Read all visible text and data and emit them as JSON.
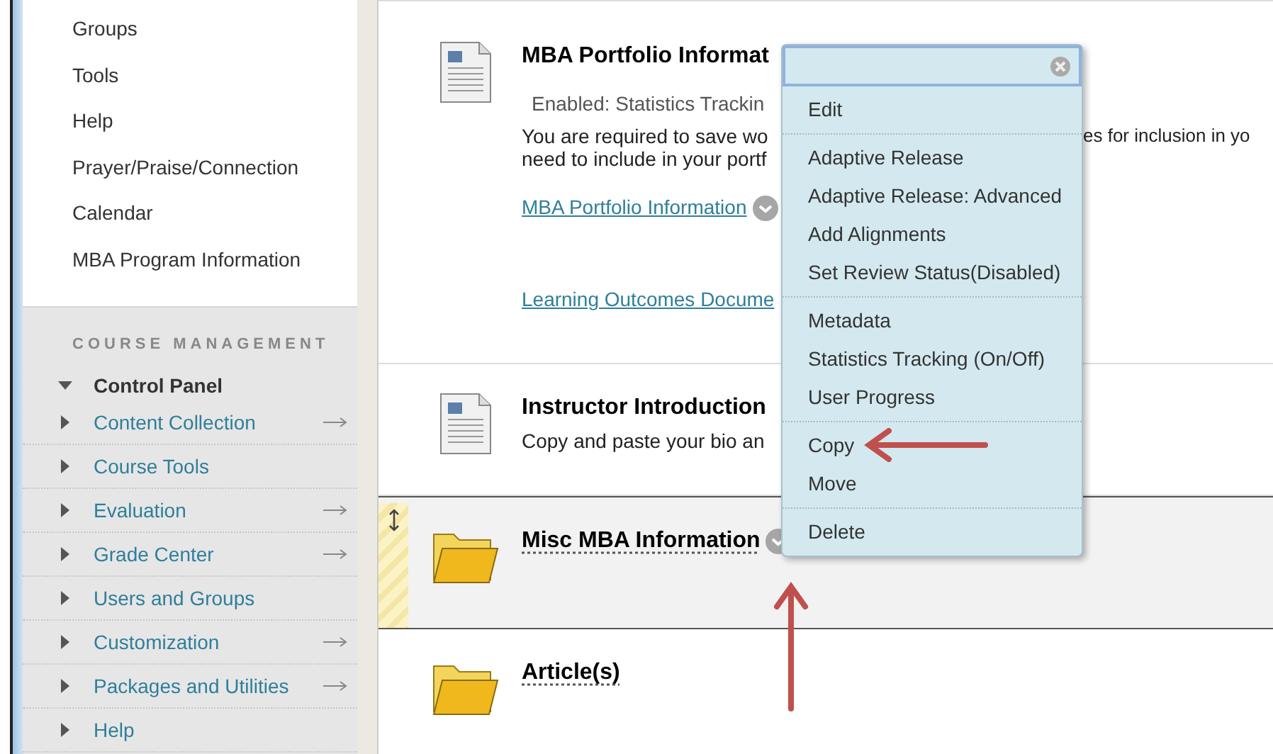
{
  "sidebar": {
    "links": [
      "Groups",
      "Tools",
      "Help",
      "Prayer/Praise/Connection",
      "Calendar",
      "MBA Program Information"
    ],
    "management": {
      "heading": "COURSE MANAGEMENT",
      "panel": {
        "label": "Control Panel",
        "expanded": true
      },
      "items": [
        {
          "label": "Content Collection",
          "expanded": false,
          "arrow": true
        },
        {
          "label": "Course Tools",
          "expanded": false,
          "arrow": false
        },
        {
          "label": "Evaluation",
          "expanded": false,
          "arrow": true
        },
        {
          "label": "Grade Center",
          "expanded": false,
          "arrow": true
        },
        {
          "label": "Users and Groups",
          "expanded": false,
          "arrow": false
        },
        {
          "label": "Customization",
          "expanded": false,
          "arrow": true
        },
        {
          "label": "Packages and Utilities",
          "expanded": false,
          "arrow": true
        },
        {
          "label": "Help",
          "expanded": false,
          "arrow": false
        }
      ]
    }
  },
  "content": [
    {
      "kind": "document",
      "title": "MBA Portfolio Informat",
      "selected": false,
      "chevron": false,
      "body": [
        {
          "kind": "status",
          "text": "Enabled:  Statistics Trackin"
        },
        {
          "kind": "text",
          "left": "You are required to save wo",
          "right": "es for inclusion in yo"
        },
        {
          "kind": "text",
          "left": "need to include in your portf"
        },
        {
          "kind": "link",
          "text": "MBA Portfolio Information",
          "chevron": true
        },
        {
          "kind": "link",
          "text": "Learning Outcomes Docume",
          "chevron": false
        }
      ]
    },
    {
      "kind": "document",
      "title": "Instructor Introduction",
      "selected": false,
      "chevron": false,
      "body": [
        {
          "kind": "text",
          "left": "Copy and paste your bio an"
        }
      ]
    },
    {
      "kind": "folder",
      "title": "Misc MBA Information",
      "selected": true,
      "chevron": true
    },
    {
      "kind": "folder",
      "title": "Article(s)",
      "selected": false,
      "chevron": false
    }
  ],
  "context_menu": {
    "groups": [
      [
        "Edit"
      ],
      [
        "Adaptive Release",
        "Adaptive Release: Advanced",
        "Add Alignments",
        "Set Review Status(Disabled)"
      ],
      [
        "Metadata",
        "Statistics Tracking (On/Off)",
        "User Progress"
      ],
      [
        "Copy",
        "Move"
      ],
      [
        "Delete"
      ]
    ]
  }
}
